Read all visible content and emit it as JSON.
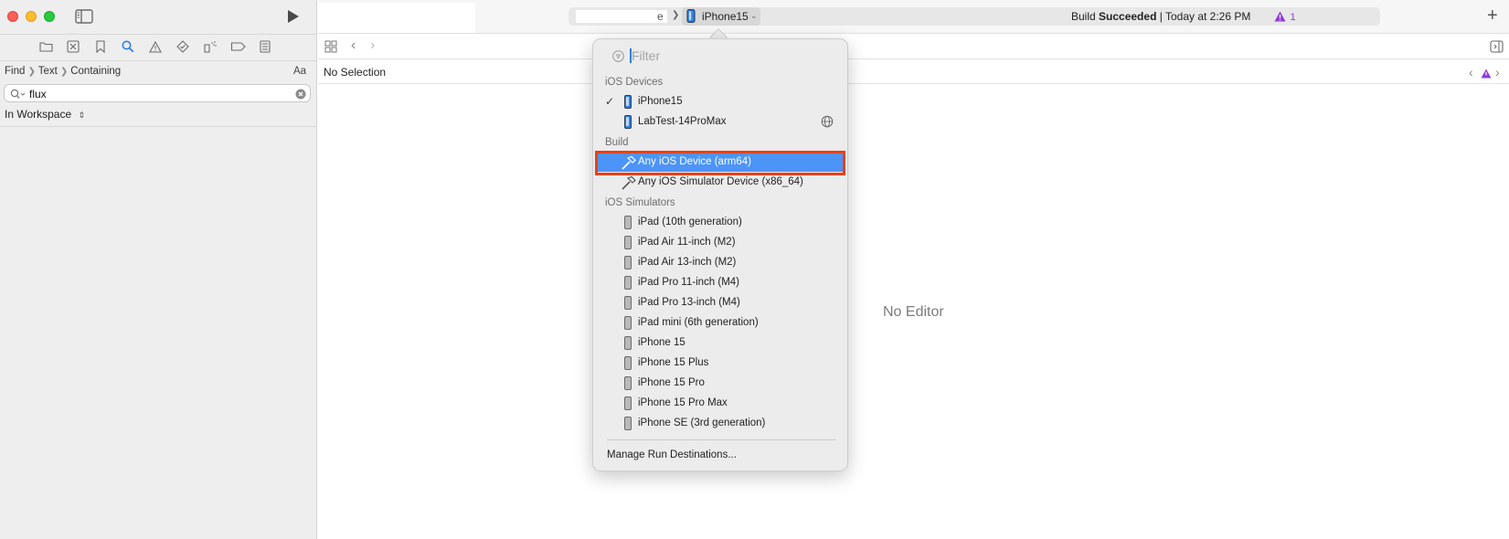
{
  "sidebar": {
    "find_path": [
      "Find",
      "Text",
      "Containing"
    ],
    "case_toggle": "Aa",
    "search": {
      "value": "flux",
      "placeholder": ""
    },
    "scope": "In Workspace"
  },
  "toolbar": {
    "scheme_partial": "e",
    "destination": "iPhone15",
    "status_prefix": "Build ",
    "status_bold": "Succeeded",
    "status_suffix": " | Today at 2:26 PM",
    "warning_count": "1"
  },
  "editor": {
    "no_selection": "No Selection",
    "no_editor": "No Editor"
  },
  "popover": {
    "filter_placeholder": "Filter",
    "sections": {
      "ios_devices": "iOS Devices",
      "build": "Build",
      "ios_simulators": "iOS Simulators"
    },
    "devices": [
      {
        "label": "iPhone15",
        "checked": true
      },
      {
        "label": "LabTest-14ProMax",
        "checked": false
      }
    ],
    "build_items": [
      {
        "label": "Any iOS Device (arm64)",
        "selected": true
      },
      {
        "label": "Any iOS Simulator Device (x86_64)",
        "selected": false
      }
    ],
    "simulators": [
      "iPad (10th generation)",
      "iPad Air 11-inch (M2)",
      "iPad Air 13-inch (M2)",
      "iPad Pro 11-inch (M4)",
      "iPad Pro 13-inch (M4)",
      "iPad mini (6th generation)",
      "iPhone 15",
      "iPhone 15 Plus",
      "iPhone 15 Pro",
      "iPhone 15 Pro Max",
      "iPhone SE (3rd generation)"
    ],
    "manage": "Manage Run Destinations..."
  },
  "colors": {
    "selection": "#4d94f8",
    "highlight_border": "#e8401c",
    "warning": "#8e3bd6"
  }
}
